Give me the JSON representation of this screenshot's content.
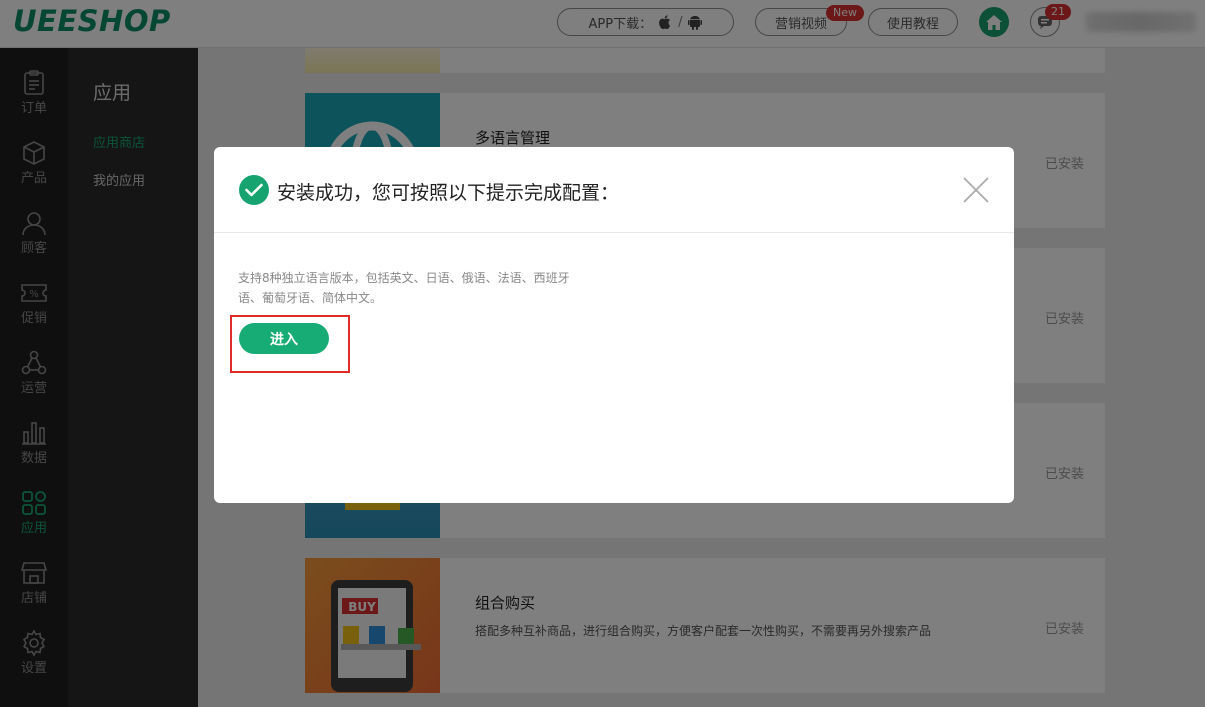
{
  "header": {
    "logo": "UEESHOP",
    "app_download_label": "APP下载：",
    "app_download_sep": "/",
    "video_label": "营销视频",
    "new_badge": "New",
    "tutorial_label": "使用教程",
    "message_count": "21"
  },
  "nav": {
    "items": [
      {
        "label": "订单",
        "icon": "order-clipboard-icon"
      },
      {
        "label": "产品",
        "icon": "product-box-icon"
      },
      {
        "label": "顾客",
        "icon": "customer-user-icon"
      },
      {
        "label": "促销",
        "icon": "promotion-ticket-icon"
      },
      {
        "label": "运营",
        "icon": "operation-nodes-icon"
      },
      {
        "label": "数据",
        "icon": "data-bars-icon"
      },
      {
        "label": "应用",
        "icon": "app-grid-icon"
      },
      {
        "label": "店铺",
        "icon": "store-icon"
      },
      {
        "label": "设置",
        "icon": "settings-gear-icon"
      }
    ],
    "active_index": 6,
    "active_color": "#19a972"
  },
  "subnav": {
    "title": "应用",
    "links": [
      "应用商店",
      "我的应用"
    ]
  },
  "apps": [
    {
      "title": "多语言管理",
      "desc": "",
      "status": "已安装"
    },
    {
      "title": "",
      "desc": "",
      "status": "已安装"
    },
    {
      "title": "",
      "desc": "",
      "status": "已安装"
    },
    {
      "title": "组合购买",
      "desc": "搭配多种互补商品，进行组合购买，方便客户配套一次性购买，不需要再另外搜索产品",
      "status": "已安装",
      "thumb_text": "BUY"
    }
  ],
  "modal": {
    "title": "安装成功，您可按照以下提示完成配置：",
    "desc": "支持8种独立语言版本，包括英文、日语、俄语、法语、西班牙语、葡萄牙语、简体中文。",
    "enter_label": "进入",
    "accent_color": "#17ab75",
    "highlight_color": "#e12b2b"
  }
}
